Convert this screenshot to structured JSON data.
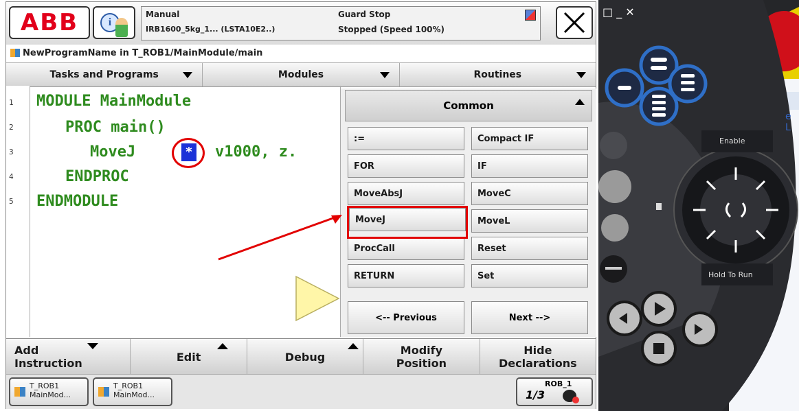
{
  "header": {
    "logo": "ABB",
    "mode": "Manual",
    "robot": "IRB1600_5kg_1... (LSTA10E2..)",
    "guard": "Guard Stop",
    "state": "Stopped (Speed 100%)"
  },
  "breadcrumb": "NewProgramName in T_ROB1/MainModule/main",
  "tabs": [
    "Tasks and Programs",
    "Modules",
    "Routines"
  ],
  "code": {
    "line_numbers": [
      "1",
      "2",
      "3",
      "4",
      "5"
    ],
    "lines": [
      "MODULE MainModule",
      "PROC main()",
      "MoveJ",
      "v1000, z.",
      "ENDPROC",
      "ENDMODULE"
    ],
    "placeholder": "*"
  },
  "common": {
    "title": "Common",
    "buttons": [
      ":=",
      "Compact IF",
      "FOR",
      "IF",
      "MoveAbsJ",
      "MoveC",
      "MoveJ",
      "MoveL",
      "ProcCall",
      "Reset",
      "RETURN",
      "Set"
    ],
    "previous": "<-- Previous",
    "next": "Next -->"
  },
  "bottom_bar": {
    "add_1": "Add",
    "add_2": "Instruction",
    "edit": "Edit",
    "debug": "Debug",
    "modify_1": "Modify",
    "modify_2": "Position",
    "hide_1": "Hide",
    "hide_2": "Declarations"
  },
  "taskbar": {
    "task1_line1": "T_ROB1",
    "task1_line2": "MainMod...",
    "task2_line1": "T_ROB1",
    "task2_line2": "MainMod...",
    "rob": "ROB_1",
    "rob_glyph": "1/3"
  },
  "pendant": {
    "enable": "Enable",
    "hold_to_run": "Hold To Run",
    "window_controls": "□ _ ✕",
    "side_text": "e L"
  },
  "colors": {
    "abb_red": "#e2001a",
    "code_green": "#2e8b1e",
    "highlight_red": "#e20000",
    "placeholder_blue": "#1b32d8",
    "pendant_blue": "#2f6fc7"
  },
  "icons": [
    "info-icon",
    "operator-icon",
    "close-icon",
    "program-icon",
    "chevron-down-icon",
    "chevron-up-icon",
    "jog-icon",
    "play-icon",
    "stop-icon",
    "step-forward-icon",
    "step-back-icon"
  ]
}
